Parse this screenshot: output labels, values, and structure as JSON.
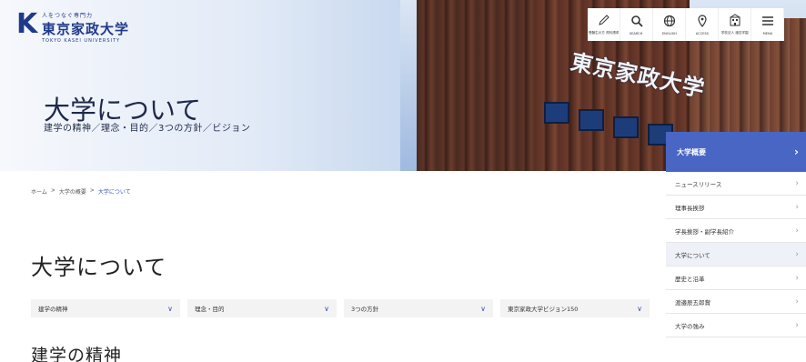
{
  "logo": {
    "tagline": "人をつなぐ専門力",
    "name": "東京家政大学",
    "name_en": "TOKYO KASEI UNIVERSITY"
  },
  "hero": {
    "title": "大学について",
    "subtitle": "建学の精神／理念・目的／3つの方針／ビジョン",
    "building_sign": "東京家政大学"
  },
  "toolbar": [
    {
      "icon": "pencil-icon",
      "label": "受験生の方 資料請求"
    },
    {
      "icon": "search-icon",
      "label": "SEARCH"
    },
    {
      "icon": "globe-icon",
      "label": "ENGLISH"
    },
    {
      "icon": "location-pin-icon",
      "label": "ACCESS"
    },
    {
      "icon": "school-building-icon",
      "label": "学校法人 渡辺学園"
    },
    {
      "icon": "menu-icon",
      "label": "MENU"
    }
  ],
  "breadcrumb": {
    "home": "ホーム",
    "sep": ">",
    "parent": "大学の概要",
    "current": "大学について"
  },
  "page_title": "大学について",
  "tabs": [
    {
      "label": "建学の精神"
    },
    {
      "label": "理念・目的"
    },
    {
      "label": "3つの方針"
    },
    {
      "label": "東京家政大学ビジョン150"
    }
  ],
  "section_title": "建学の精神",
  "side_nav": {
    "head": "大学概要",
    "items": [
      {
        "label": "ニュースリリース",
        "active": false
      },
      {
        "label": "理事長挨拶",
        "active": false
      },
      {
        "label": "学長挨拶・副学長紹介",
        "active": false
      },
      {
        "label": "大学について",
        "active": true
      },
      {
        "label": "歴史と沿革",
        "active": false
      },
      {
        "label": "渡邉辰五郎賞",
        "active": false
      },
      {
        "label": "大学の強み",
        "active": false
      }
    ]
  },
  "colors": {
    "brand": "#1f3a8a",
    "accent": "#4a66c4",
    "tab_bg": "#f3f3f3"
  }
}
